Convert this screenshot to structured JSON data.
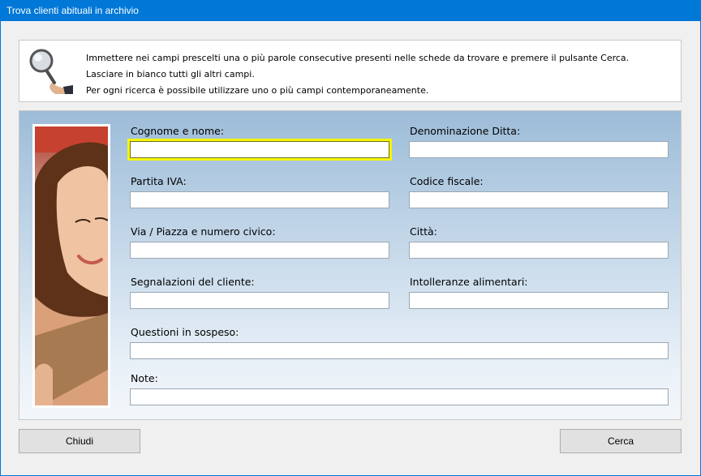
{
  "window": {
    "title": "Trova clienti abituali in archivio"
  },
  "info": {
    "icon": "magnifier-hand-icon",
    "lines": [
      "Immettere nei campi prescelti una o più parole consecutive presenti nelle schede da trovare e premere il pulsante Cerca.",
      "Lasciare in bianco tutti gli altri campi.",
      "Per ogni ricerca è possibile utilizzare uno o più campi contemporaneamente."
    ]
  },
  "fields": {
    "nome": {
      "label": "Cognome e nome:",
      "value": ""
    },
    "ditta": {
      "label": "Denominazione Ditta:",
      "value": ""
    },
    "piva": {
      "label": "Partita IVA:",
      "value": ""
    },
    "cf": {
      "label": "Codice fiscale:",
      "value": ""
    },
    "via": {
      "label": "Via / Piazza e numero civico:",
      "value": ""
    },
    "citta": {
      "label": "Città:",
      "value": ""
    },
    "segnalazioni": {
      "label": "Segnalazioni del cliente:",
      "value": ""
    },
    "intolleranze": {
      "label": "Intolleranze alimentari:",
      "value": ""
    },
    "questioni": {
      "label": "Questioni in sospeso:",
      "value": ""
    },
    "note": {
      "label": "Note:",
      "value": ""
    }
  },
  "buttons": {
    "close": "Chiudi",
    "search": "Cerca"
  }
}
